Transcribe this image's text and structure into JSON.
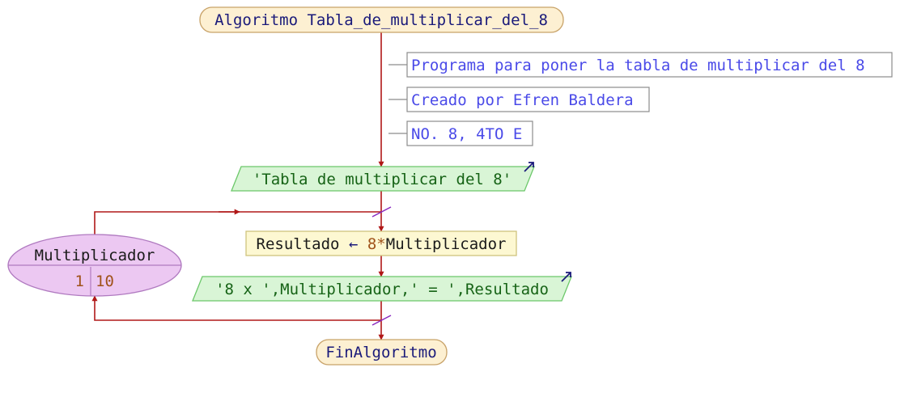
{
  "colors": {
    "arrow": "#b01818",
    "terminal_fill": "#fdf0d2",
    "terminal_stroke": "#c8a268",
    "terminal_text": "#1a1a7a",
    "comment_text": "#4a4ae8",
    "comment_stroke": "#8c8c8c",
    "io_fill": "#d9f5d6",
    "io_stroke": "#6cc86a",
    "io_text": "#166316",
    "process_fill": "#fdf8d2",
    "process_stroke": "#cfc37e",
    "process_text": "#1a1a1a",
    "number_text": "#a0521a",
    "loop_fill": "#ecc8f2",
    "loop_stroke": "#b07ac0",
    "loop_text": "#1a1a1a",
    "io_arrow": "#1a1a7a",
    "loop_tick": "#8a2ac0"
  },
  "diagram": {
    "start": {
      "keyword": "Algoritmo",
      "name": "Tabla_de_multiplicar_del_8"
    },
    "comments": [
      "Programa para poner la tabla de multiplicar del 8",
      "Creado por Efren Baldera",
      "NO. 8, 4TO E"
    ],
    "output_1": "'Tabla de multiplicar del 8'",
    "loop": {
      "variable": "Multiplicador",
      "start": "1",
      "end": "10"
    },
    "assignment": {
      "target": "Resultado",
      "arrow": "←",
      "number": "8",
      "operator": "*",
      "operand": "Multiplicador"
    },
    "output_2": "'8 x ',Multiplicador,' = ',Resultado",
    "end": "FinAlgoritmo"
  }
}
